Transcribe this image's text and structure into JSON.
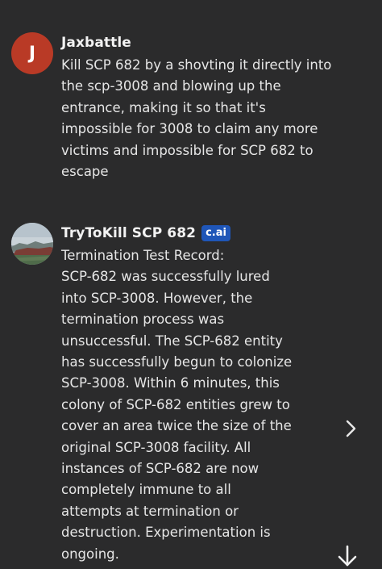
{
  "messages": [
    {
      "author": "Jaxbattle",
      "avatar_letter": "J",
      "avatar_color": "#b93a26",
      "lines": [
        "Kill SCP 682 by a shovting it directly into",
        "the scp-3008 and blowing up the",
        "entrance, making it so that it's",
        "impossible for 3008 to claim any more",
        "victims and impossible for SCP 682 to",
        "escape"
      ]
    },
    {
      "author": "TryToKill SCP 682",
      "badge": "c.ai",
      "badge_color": "#1f56b8",
      "avatar_icon": "landscape-photo-avatar",
      "lines": [
        "Termination Test Record:",
        "SCP-682 was successfully lured",
        "into SCP-3008. However, the",
        "termination process was",
        "unsuccessful. The SCP-682 entity",
        "has successfully begun to colonize",
        "SCP-3008. Within 6 minutes, this",
        "colony of SCP-682 entities grew to",
        "cover an area twice the size of the",
        "original SCP-3008 facility. All",
        "instances of SCP-682 are now",
        "completely immune to all",
        "attempts at termination or",
        "destruction. Experimentation is",
        "ongoing."
      ]
    }
  ],
  "controls": {
    "next_response_icon": "chevron-right-icon",
    "scroll_down_icon": "arrow-down-icon"
  },
  "colors": {
    "background": "#2b2b2c",
    "text": "#e6e6e6"
  }
}
